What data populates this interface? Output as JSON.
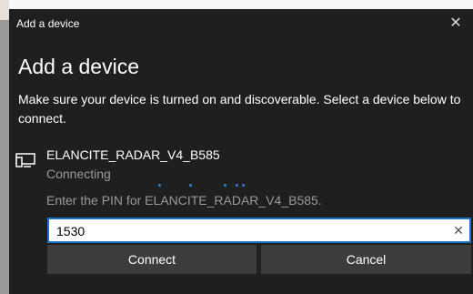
{
  "dialog": {
    "title": "Add a device",
    "heading": "Add a device",
    "description": "Make sure your device is turned on and discoverable. Select a device below to connect.",
    "close_glyph": "✕"
  },
  "device": {
    "name": "ELANCITE_RADAR_V4_B585",
    "status": "Connecting",
    "icon": "display-device-icon"
  },
  "pin": {
    "prompt": "Enter the PIN for ELANCITE_RADAR_V4_B585.",
    "value": "1530",
    "clear_glyph": "✕"
  },
  "buttons": {
    "connect": "Connect",
    "cancel": "Cancel"
  },
  "colors": {
    "dialog_bg": "#1f1f1f",
    "accent": "#1a73c7",
    "secondary_text": "#9a9a9a",
    "button_bg": "#3c3c3c"
  }
}
